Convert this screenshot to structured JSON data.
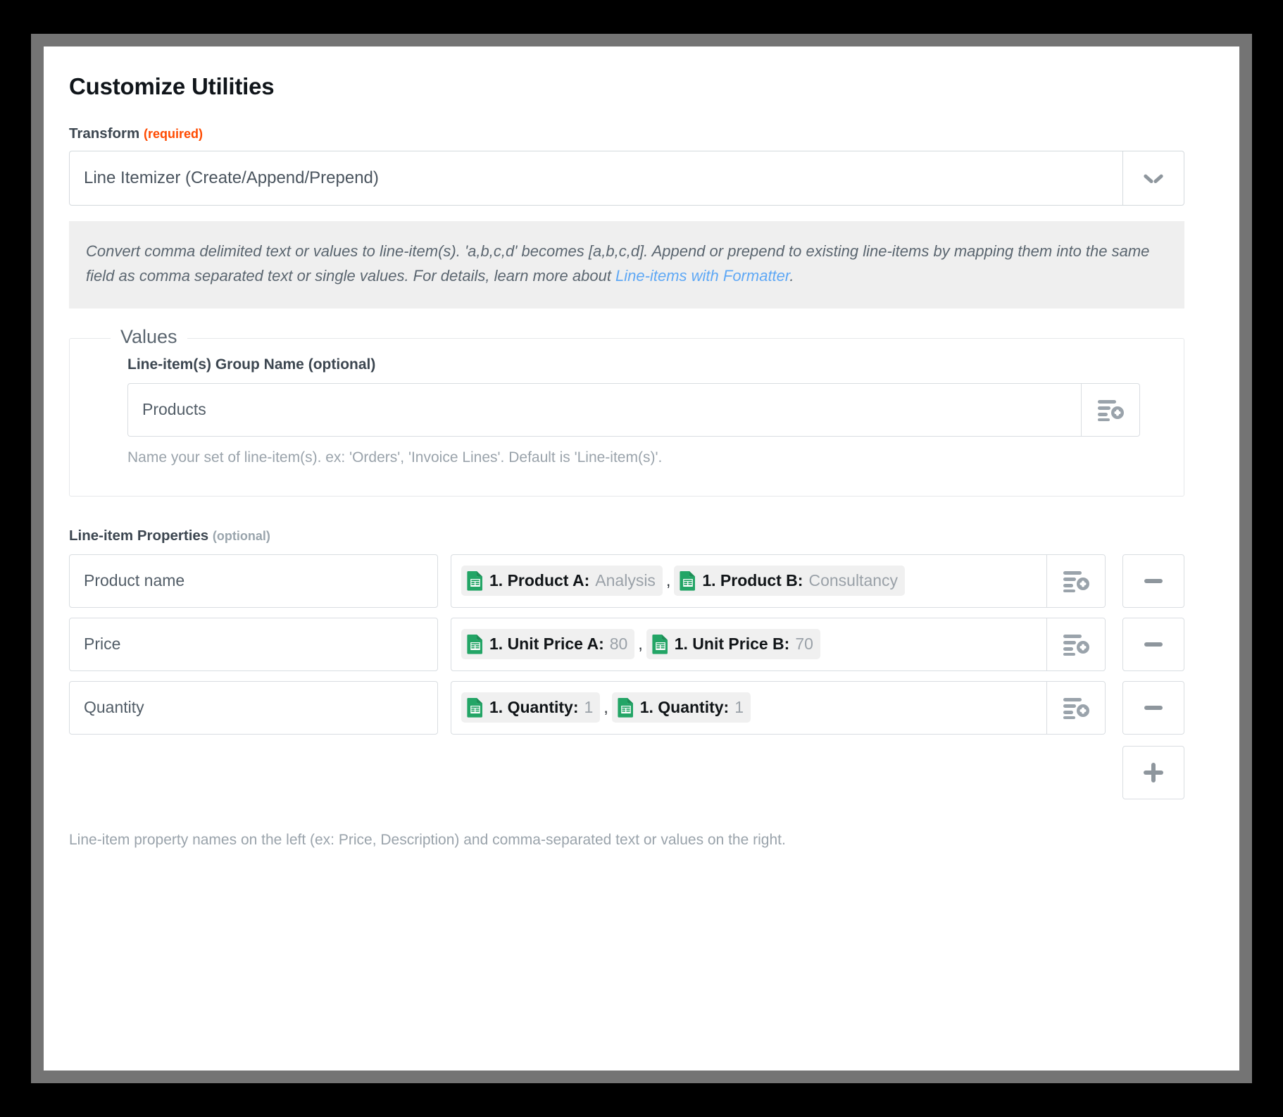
{
  "window": {
    "title": "Customize Utilities"
  },
  "transform": {
    "label": "Transform",
    "required_tag": "(required)",
    "selected": "Line Itemizer (Create/Append/Prepend)",
    "caret_icon": "chevron-down-icon",
    "description_part1": "Convert comma delimited text or values to line-item(s). 'a,b,c,d' becomes [a,b,c,d]. Append or prepend to existing line-items by mapping them into the same field as comma separated text or single values. For details, learn more about ",
    "description_link": "Line-items with Formatter",
    "description_part2": ".",
    "link_color": "#5fa8f5"
  },
  "values_section": {
    "legend": "Values",
    "group_name": {
      "label": "Line-item(s) Group Name",
      "optional_tag": "(optional)",
      "value": "Products",
      "map_icon": "insert-field-icon",
      "help": "Name your set of line-item(s). ex: 'Orders', 'Invoice Lines'. Default is 'Line-item(s)'."
    }
  },
  "line_item_properties": {
    "label": "Line-item Properties",
    "optional_tag": "(optional)",
    "map_icon": "insert-field-icon",
    "remove_icon": "minus-icon",
    "add_icon": "plus-icon",
    "separator": ",",
    "rows": [
      {
        "name": "Product name",
        "tokens": [
          {
            "icon": "google-sheets-icon",
            "key": "1. Product A:",
            "value": "Analysis"
          },
          {
            "icon": "google-sheets-icon",
            "key": "1. Product B:",
            "value": "Consultancy"
          }
        ]
      },
      {
        "name": "Price",
        "tokens": [
          {
            "icon": "google-sheets-icon",
            "key": "1. Unit Price A:",
            "value": "80"
          },
          {
            "icon": "google-sheets-icon",
            "key": "1. Unit Price B:",
            "value": "70"
          }
        ]
      },
      {
        "name": "Quantity",
        "tokens": [
          {
            "icon": "google-sheets-icon",
            "key": "1. Quantity:",
            "value": "1"
          },
          {
            "icon": "google-sheets-icon",
            "key": "1. Quantity:",
            "value": "1"
          }
        ]
      }
    ],
    "footer_note": "Line-item property names on the left (ex: Price, Description) and comma-separated text or values on the right."
  },
  "colors": {
    "accent_required": "#ff4a00",
    "link": "#5fa8f5",
    "sheets_green": "#23a566",
    "panel_frame": "#747474"
  }
}
